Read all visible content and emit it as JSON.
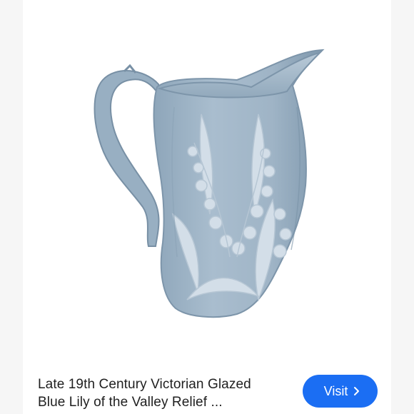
{
  "result": {
    "image": {
      "subject": "blue glazed pitcher with lily of the valley relief",
      "colors": {
        "glaze": "#9fb4c6",
        "glaze_dark": "#7f98ad",
        "relief": "#d7e1ea",
        "background": "#ffffff"
      }
    },
    "title_lines": [
      "Late 19th Century Victorian Glazed",
      "Blue Lily of the Valley Relief ..."
    ],
    "visit_button": {
      "label": "Visit",
      "icon": "chevron-right-icon",
      "color": "#1b6ef3"
    }
  }
}
